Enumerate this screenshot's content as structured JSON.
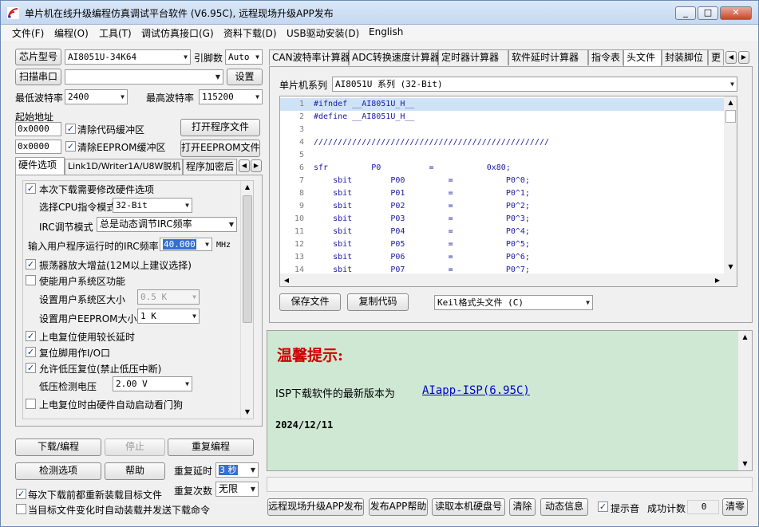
{
  "window": {
    "title": "单片机在线升级编程仿真调试平台软件 (V6.95C), 远程现场升级APP发布",
    "min": "_",
    "max": "□",
    "close": "✕"
  },
  "menu": [
    "文件(F)",
    "编程(O)",
    "工具(T)",
    "调试仿真接口(G)",
    "资料下载(D)",
    "USB驱动安装(D)",
    "English"
  ],
  "left": {
    "chip_btn": "芯片型号",
    "chip_value": "AI8051U-34K64",
    "pins_label": "引脚数",
    "pins_value": "Auto",
    "scan_btn": "扫描串口",
    "port_value": "",
    "settings_btn": "设置",
    "min_baud_label": "最低波特率",
    "min_baud_value": "2400",
    "max_baud_label": "最高波特率",
    "max_baud_value": "115200",
    "start_addr_label": "起始地址",
    "addr1": "0x0000",
    "clear_code_label": "清除代码缓冲区",
    "open_prog_btn": "打开程序文件",
    "addr2": "0x0000",
    "clear_eeprom_label": "清除EEPROM缓冲区",
    "open_eeprom_btn": "打开EEPROM文件",
    "tabs": [
      "硬件选项",
      "Link1D/Writer1A/U8W脱机",
      "程序加密后"
    ],
    "hw": {
      "modify_label": "本次下载需要修改硬件选项",
      "cpu_mode_label": "选择CPU指令模式",
      "cpu_mode_value": "32-Bit",
      "irc_mode_label": "IRC调节模式",
      "irc_mode_value": "总是动态调节IRC频率",
      "irc_freq_label": "输入用户程序运行时的IRC频率",
      "irc_freq_value": "40.000",
      "irc_unit": "MHz",
      "osc_label": "振荡器放大增益(12M以上建议选择)",
      "sysarea_label": "使能用户系统区功能",
      "sysarea_size_label": "设置用户系统区大小",
      "sysarea_size_value": "0.5 K",
      "eeprom_size_label": "设置用户EEPROM大小",
      "eeprom_size_value": "1   K",
      "long_reset_label": "上电复位使用较长延时",
      "reset_io_label": "复位脚用作I/O口",
      "lvr_label": "允许低压复位(禁止低压中断)",
      "lvd_label": "低压检测电压",
      "lvd_value": "2.00 V",
      "wdt_label": "上电复位时由硬件自动启动看门狗"
    },
    "download_btn": "下载/编程",
    "stop_btn": "停止",
    "reprog_btn": "重复编程",
    "detect_btn": "检测选项",
    "help_btn": "帮助",
    "repeat_delay_label": "重复延时",
    "repeat_delay_value": "3 秒",
    "repeat_count_label": "重复次数",
    "repeat_count_value": "无限",
    "reload_label": "每次下载前都重新装载目标文件",
    "auto_label": "当目标文件变化时自动装载并发送下载命令"
  },
  "right": {
    "tabs": [
      "CAN波特率计算器",
      "ADC转换速度计算器",
      "定时器计算器",
      "软件延时计算器",
      "指令表",
      "头文件",
      "封装脚位",
      "更"
    ],
    "series_label": "单片机系列",
    "series_value": "AI8051U 系列 (32-Bit)",
    "code": [
      {
        "n": "1",
        "t": "#ifndef __AI8051U_H__"
      },
      {
        "n": "2",
        "t": "#define __AI8051U_H__"
      },
      {
        "n": "3",
        "t": ""
      },
      {
        "n": "4",
        "t": "/////////////////////////////////////////////////"
      },
      {
        "n": "5",
        "t": ""
      },
      {
        "n": "6",
        "t": "sfr         P0          =           0x80;"
      },
      {
        "n": "7",
        "t": "    sbit        P00         =           P0^0;"
      },
      {
        "n": "8",
        "t": "    sbit        P01         =           P0^1;"
      },
      {
        "n": "9",
        "t": "    sbit        P02         =           P0^2;"
      },
      {
        "n": "10",
        "t": "    sbit        P03         =           P0^3;"
      },
      {
        "n": "11",
        "t": "    sbit        P04         =           P0^4;"
      },
      {
        "n": "12",
        "t": "    sbit        P05         =           P0^5;"
      },
      {
        "n": "13",
        "t": "    sbit        P06         =           P0^6;"
      },
      {
        "n": "14",
        "t": "    sbit        P07         =           P0^7;"
      }
    ],
    "save_btn": "保存文件",
    "copy_btn": "复制代码",
    "format_value": "Keil格式头文件 (C)",
    "notice_title": "温馨提示:",
    "notice_text": "ISP下载软件的最新版本为",
    "notice_link": "AIapp-ISP(6.95C)",
    "notice_date": "2024/12/11",
    "bottom": {
      "remote_btn": "远程现场升级APP发布",
      "publish_help_btn": "发布APP帮助",
      "read_disk_btn": "读取本机硬盘号",
      "clear_btn": "清除",
      "dynamic_btn": "动态信息",
      "beep_label": "提示音",
      "success_label": "成功计数",
      "success_value": "0",
      "zero_btn": "清零"
    }
  },
  "colors": {
    "notice_bg": "#cfe8d3",
    "notice_title": "#d00000",
    "link": "#0000cc",
    "highlight": "#cfe3f7"
  }
}
